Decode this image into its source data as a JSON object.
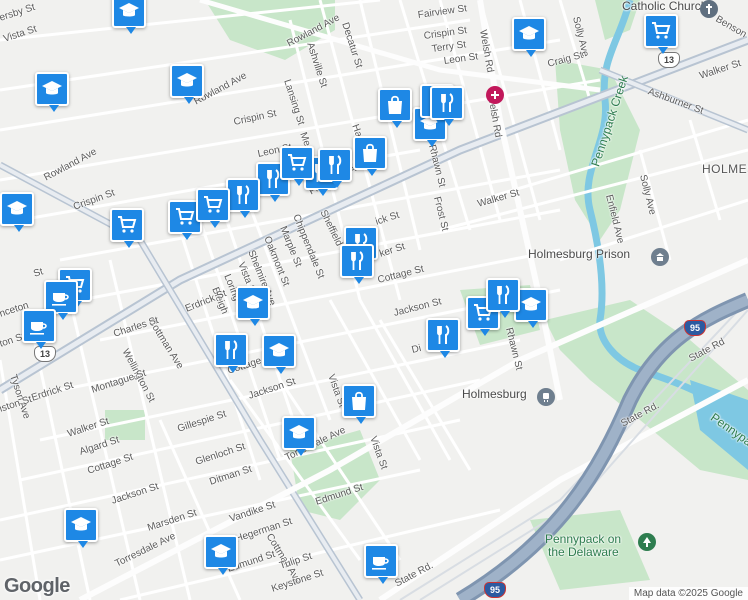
{
  "map": {
    "labels": {
      "catholic_church": "Catholic Church",
      "holmesburg_prison": "Holmesburg Prison",
      "holmesburg": "Holmesburg",
      "holmes": "HOLMESBU",
      "pennypack_creek": "Pennypack Creek",
      "pennypack_park": "Pennypack",
      "pennypack_park2": "Pennypack on",
      "pennypack_park3": "the Delaware"
    },
    "streets": {
      "fairview": "Fairview St",
      "crispin_top": "Crispin St",
      "terry": "Terry St",
      "leon_top": "Leon St",
      "craig": "Craig St",
      "decatur": "Decatur St",
      "ashville": "Ashville St",
      "rowland_top": "Rowland Ave",
      "rowland_left": "Rowland Ave",
      "rowland_far": "Rowland Ave",
      "lansing": "Lansing St",
      "crispin_mid": "Crispin St",
      "crispin_left": "Crispin St",
      "leon_mid": "Leon St",
      "welsh_top": "Welsh Rd",
      "welsh_mid": "Welsh Rd",
      "rawn_top": "Rhawn St",
      "rawn_bottom": "Rhawn St",
      "frost": "Frost St",
      "walker_mid": "Walker St",
      "walker_right": "Walker St",
      "ashburner": "Ashburner St",
      "solly_top": "Solly Ave",
      "solly_right": "Solly Ave",
      "enfield": "Enfield Ave",
      "frankford": "Frankford Ave",
      "sheffield": "Sheffield",
      "chippendale": "Chippendale St",
      "marple": "Marple St",
      "oakmont": "Oakmont St",
      "shelmire": "Shelmire Ave",
      "vista_mid": "Vista St",
      "loring": "Loring St",
      "bleigh": "Bleigh",
      "cottage_mid": "Cottage St",
      "jackson_mid": "Jackson St",
      "ditman_frag": "Di",
      "erdrick_mid": "Erdrick St",
      "cottman": "Cottman Ave",
      "cottman_low": "Cottman Ave",
      "charles": "Charles St",
      "wellington": "Wellington St",
      "erdrick_left": "Erdrick St",
      "montague": "Montague St",
      "walker_left": "Walker St",
      "algard": "Algard St",
      "cottage_left": "Cottage St",
      "jackson_left": "Jackson St",
      "jackson_low": "Jackson St",
      "tyson": "Tyson Ave",
      "gillespie": "Gillespie St",
      "glenloch": "Glenloch St",
      "ditman": "Ditman St",
      "cottage_frag": "Cottage",
      "vista_low": "Vista St",
      "vista_lower": "Vista St",
      "torresdale": "Torresdale Ave",
      "torresdale_low": "Torresdale Ave",
      "edmund": "Edmund St",
      "edmund_low": "Edmund St",
      "marsden": "Marsden St",
      "vandike": "Vandike St",
      "hegerman": "Hegerman St",
      "tulip": "Tulip St",
      "keystone": "Keystone St",
      "state_rd_right": "State Rd",
      "state_rd": "State Rd.",
      "state_rd_low": "State Rd.",
      "benson": "Benson",
      "vista_top": "Vista St",
      "sey": "ersby St",
      "princeton": "nceton",
      "ton": "ton St",
      "iston": "iston St",
      "st_frag": "St",
      "ick_frag": "ick St",
      "ker_frag": "ker St",
      "ha_frag": "Ha",
      "ce_frag": "ceton",
      "me_frag": "Me"
    },
    "routes": {
      "us13_top": "13",
      "us13_left": "13",
      "i95": "95"
    },
    "markers": [
      {
        "type": "school",
        "name": "school-icon"
      },
      {
        "type": "school",
        "name": "school-icon"
      },
      {
        "type": "school",
        "name": "school-icon"
      },
      {
        "type": "grocery",
        "name": "cart-icon"
      },
      {
        "type": "shopping",
        "name": "shopping-bag-icon"
      }
    ],
    "footer": {
      "logo": "Google",
      "credit": "Map data ©2025 Google"
    },
    "colors": {
      "pin": "#1e88e5",
      "park": "#c8e6c9",
      "water": "#7ec8e3",
      "highway": "#8a9db5",
      "prison_marker": "#6f7f8f",
      "church_marker": "#5f6f7f",
      "hospital_marker": "#c2185b"
    }
  }
}
